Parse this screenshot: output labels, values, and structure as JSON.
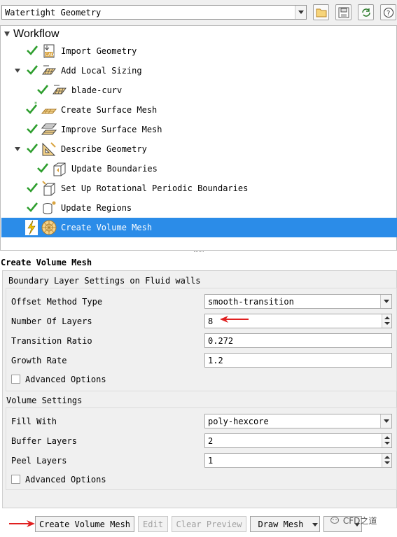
{
  "topbar": {
    "workflow_type": "Watertight Geometry",
    "icons": [
      "open-folder-icon",
      "save-icon",
      "refresh-icon",
      "help-icon"
    ]
  },
  "workflow": {
    "title": "Workflow",
    "items": [
      {
        "label": "Import Geometry",
        "status": "done",
        "icon": "cad-import-icon"
      },
      {
        "label": "Add Local Sizing",
        "status": "done",
        "icon": "local-sizing-icon"
      },
      {
        "label": "blade-curv",
        "status": "done",
        "icon": "local-sizing-icon"
      },
      {
        "label": "Create Surface Mesh",
        "status": "done-pending",
        "icon": "surface-mesh-icon"
      },
      {
        "label": "Improve Surface Mesh",
        "status": "done",
        "icon": "improve-mesh-icon"
      },
      {
        "label": "Describe Geometry",
        "status": "done",
        "icon": "describe-geometry-icon"
      },
      {
        "label": "Update Boundaries",
        "status": "done",
        "icon": "update-boundaries-icon"
      },
      {
        "label": "Set Up Rotational Periodic Boundaries",
        "status": "done",
        "icon": "periodic-boundaries-icon"
      },
      {
        "label": "Update Regions",
        "status": "done",
        "icon": "update-regions-icon"
      },
      {
        "label": "Create Volume Mesh",
        "status": "active",
        "icon": "volume-mesh-icon"
      }
    ]
  },
  "task": {
    "title": "Create Volume Mesh",
    "boundary_section": {
      "title": "Boundary Layer Settings on Fluid walls",
      "offset_method_label": "Offset Method Type",
      "offset_method_value": "smooth-transition",
      "layers_label": "Number Of Layers",
      "layers_value": "8",
      "transition_label": "Transition Ratio",
      "transition_value": "0.272",
      "growth_label": "Growth Rate",
      "growth_value": "1.2",
      "advanced_label": "Advanced Options"
    },
    "volume_section": {
      "title": "Volume Settings",
      "fill_label": "Fill With",
      "fill_value": "poly-hexcore",
      "buffer_label": "Buffer Layers",
      "buffer_value": "2",
      "peel_label": "Peel Layers",
      "peel_value": "1",
      "advanced_label": "Advanced Options"
    }
  },
  "buttons": {
    "create": "Create Volume Mesh",
    "edit": "Edit",
    "clear": "Clear Preview",
    "draw": "Draw Mesh"
  },
  "watermark": "CFD之道",
  "colors": {
    "selection": "#2b8ce8",
    "check": "#2e9e2e",
    "annotation_arrow": "#e02020",
    "icon_gold": "#d9a441"
  }
}
